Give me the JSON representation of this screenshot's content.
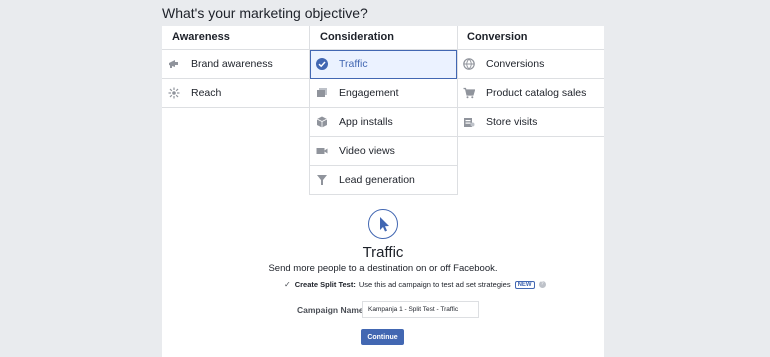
{
  "page": {
    "heading": "What's your marketing objective?"
  },
  "objectives": {
    "columns": [
      {
        "title": "Awareness",
        "items": [
          {
            "label": "Brand awareness",
            "icon": "megaphone-icon"
          },
          {
            "label": "Reach",
            "icon": "reach-icon"
          }
        ]
      },
      {
        "title": "Consideration",
        "items": [
          {
            "label": "Traffic",
            "icon": "checkmark-icon",
            "selected": true
          },
          {
            "label": "Engagement",
            "icon": "engagement-icon"
          },
          {
            "label": "App installs",
            "icon": "cube-icon"
          },
          {
            "label": "Video views",
            "icon": "video-camera-icon"
          },
          {
            "label": "Lead generation",
            "icon": "funnel-icon"
          }
        ]
      },
      {
        "title": "Conversion",
        "items": [
          {
            "label": "Conversions",
            "icon": "globe-icon"
          },
          {
            "label": "Product catalog sales",
            "icon": "cart-icon"
          },
          {
            "label": "Store visits",
            "icon": "store-icon"
          }
        ]
      }
    ]
  },
  "detail": {
    "icon": "cursor-icon",
    "title": "Traffic",
    "description": "Send more people to a destination on or off Facebook.",
    "split_test": {
      "checked": true,
      "label": "Create Split Test:",
      "text": "Use this ad campaign to test ad set strategies",
      "badge": "NEW"
    },
    "campaign_name": {
      "label": "Campaign Name",
      "value": "Kampanja 1 - Split Test - Traffic"
    },
    "continue_label": "Continue"
  },
  "colors": {
    "accent": "#4267b2",
    "background": "#e9ebee",
    "selected_bg": "#ebf2ff"
  }
}
